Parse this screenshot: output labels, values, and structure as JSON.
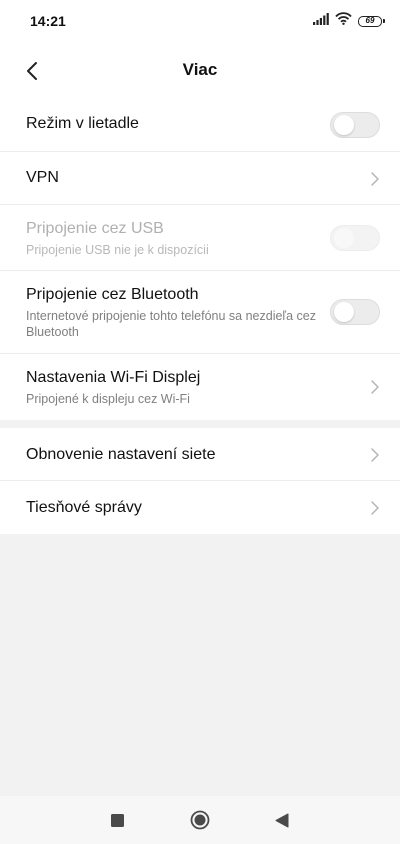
{
  "status_bar": {
    "time": "14:21",
    "battery": "69",
    "icons": [
      "signal-icon",
      "wifi-icon",
      "battery-icon"
    ]
  },
  "header": {
    "title": "Viac",
    "back_icon": "chevron-left-icon"
  },
  "settings": [
    {
      "title": "Režim v lietadle",
      "control": "toggle",
      "state": "off",
      "enabled": true
    },
    {
      "title": "VPN",
      "control": "chevron",
      "enabled": true
    },
    {
      "title": "Pripojenie cez USB",
      "subtitle": "Pripojenie USB nie je k dispozícii",
      "control": "toggle",
      "state": "off",
      "enabled": false
    },
    {
      "title": "Pripojenie cez Bluetooth",
      "subtitle": "Internetové pripojenie tohto telefónu sa nezdieľa cez Bluetooth",
      "control": "toggle",
      "state": "off",
      "enabled": true
    },
    {
      "title": "Nastavenia Wi-Fi Displej",
      "subtitle": "Pripojené k displeju cez Wi-Fi",
      "control": "chevron",
      "enabled": true
    }
  ],
  "settings_secondary": [
    {
      "title": "Obnovenie nastavení siete",
      "control": "chevron",
      "enabled": true
    },
    {
      "title": "Tiesňové správy",
      "control": "chevron",
      "enabled": true
    }
  ],
  "nav_bar": {
    "buttons": [
      "recent-apps-icon",
      "home-icon",
      "back-icon"
    ]
  },
  "colors": {
    "background": "#f2f2f2",
    "card": "#ffffff",
    "text_primary": "#111111",
    "text_secondary": "#808080",
    "text_disabled": "#b0b0b0"
  }
}
